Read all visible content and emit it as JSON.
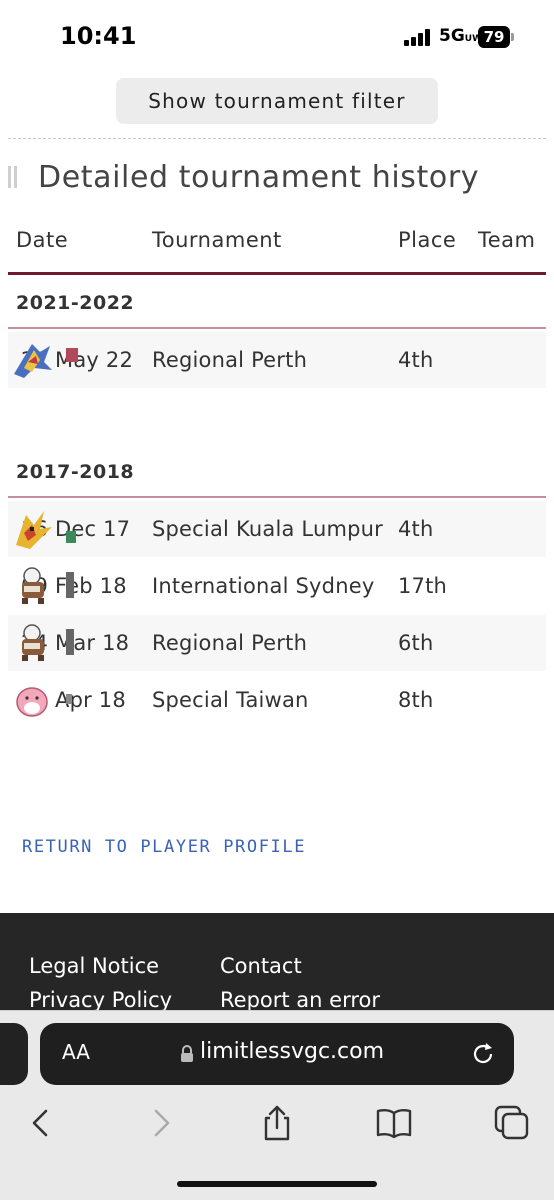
{
  "status_bar": {
    "time": "10:41",
    "network": "5G",
    "network_sub": "UW",
    "battery": "79"
  },
  "filter_button": "Show tournament filter",
  "section_title": "Detailed tournament history",
  "table": {
    "headers": {
      "date": "Date",
      "tournament": "Tournament",
      "place": "Place",
      "team": "Team"
    },
    "seasons": [
      {
        "label": "2021-2022",
        "rows": [
          {
            "date": "21 May 22",
            "tournament": "Regional Perth",
            "place": "4th"
          }
        ]
      },
      {
        "label": "2017-2018",
        "rows": [
          {
            "date": "16 Dec 17",
            "tournament": "Special Kuala Lumpur",
            "place": "4th"
          },
          {
            "date": "09 Feb 18",
            "tournament": "International Sydney",
            "place": "17th"
          },
          {
            "date": "24 Mar 18",
            "tournament": "Regional Perth",
            "place": "6th"
          },
          {
            "date": "21 Apr 18",
            "tournament": "Special Taiwan",
            "place": "8th"
          }
        ]
      }
    ]
  },
  "return_link": "RETURN TO PLAYER PROFILE",
  "footer": {
    "legal": "Legal Notice",
    "contact": "Contact",
    "privacy": "Privacy Policy",
    "report": "Report an error"
  },
  "browser": {
    "text_size": "AA",
    "url": "limitlessvgc.com"
  },
  "colors": {
    "accent_line": "#6d1a2a",
    "season_line": "#c4909c",
    "link": "#3a63b8",
    "footer_bg": "#262626"
  }
}
